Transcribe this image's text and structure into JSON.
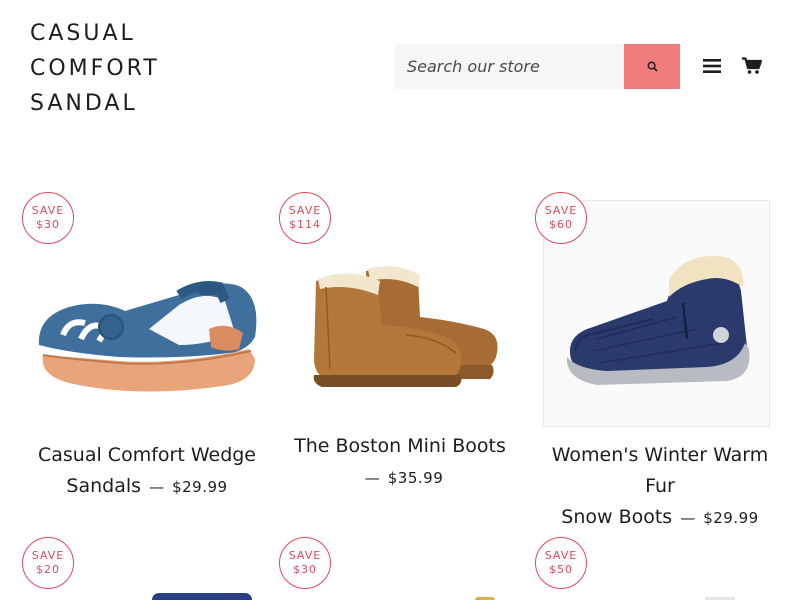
{
  "brand": {
    "line1": "CASUAL",
    "line2": "COMFORT",
    "line3": "SANDAL"
  },
  "search": {
    "placeholder": "Search our store",
    "value": ""
  },
  "header": {
    "menu_icon": "hamburger-menu-icon",
    "cart_icon": "cart-icon",
    "search_icon": "search-icon"
  },
  "colors": {
    "accent": "#f07b7b",
    "badge": "#e0495a",
    "text": "#1c1d1d"
  },
  "products": [
    {
      "title_line1": "Casual Comfort Wedge",
      "title_line2": "Sandals",
      "price": "$29.99",
      "badge_label": "SAVE",
      "badge_amount": "$30",
      "image": "blue-wedge-sandal"
    },
    {
      "title": "The Boston Mini Boots",
      "price": "$35.99",
      "badge_label": "SAVE",
      "badge_amount": "$114",
      "image": "tan-mini-boots"
    },
    {
      "title_line1": "Women's Winter Warm Fur",
      "title_line2": "Snow Boots",
      "price": "$29.99",
      "badge_label": "SAVE",
      "badge_amount": "$60",
      "image": "navy-snow-boot"
    },
    {
      "badge_label": "SAVE",
      "badge_amount": "$20"
    },
    {
      "badge_label": "SAVE",
      "badge_amount": "$30"
    },
    {
      "badge_label": "SAVE",
      "badge_amount": "$50"
    }
  ],
  "dash": "—"
}
